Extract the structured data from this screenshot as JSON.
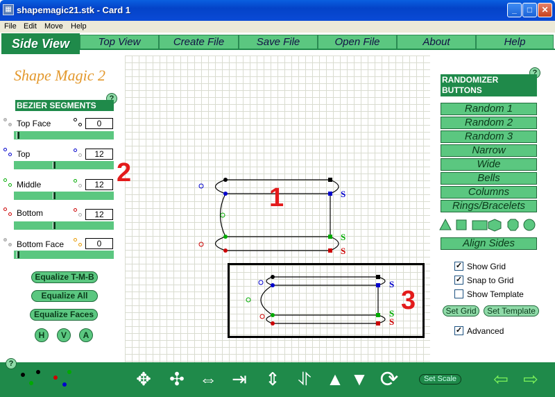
{
  "window": {
    "title": "shapemagic21.stk - Card 1"
  },
  "menus": [
    "File",
    "Edit",
    "Move",
    "Help"
  ],
  "tabs": {
    "side": "Side View",
    "items": [
      "Top View",
      "Create File",
      "Save File",
      "Open File",
      "About",
      "Help"
    ]
  },
  "logo": "Shape Magic 2",
  "help_glyph": "?",
  "bezier": {
    "header": "BEZIER SEGMENTS",
    "rows": [
      {
        "label": "Top Face",
        "value": "0",
        "level": 0.0
      },
      {
        "label": "Top",
        "value": "12",
        "level": 0.4
      },
      {
        "label": "Middle",
        "value": "12",
        "level": 0.4
      },
      {
        "label": "Bottom",
        "value": "12",
        "level": 0.4
      },
      {
        "label": "Bottom Face",
        "value": "0",
        "level": 0.0
      }
    ]
  },
  "equalize_buttons": [
    "Equalize T-M-B",
    "Equalize All",
    "Equalize Faces"
  ],
  "constraint_buttons": [
    "H",
    "V",
    "A"
  ],
  "canvas_labels": {
    "one": "1",
    "two": "2",
    "three": "3",
    "s": "S"
  },
  "randomizer": {
    "header_line1": "RANDOMIZER",
    "header_line2": "BUTTONS",
    "buttons": [
      "Random 1",
      "Random 2",
      "Random 3",
      "Narrow",
      "Wide",
      "Bells",
      "Columns",
      "Rings/Bracelets"
    ]
  },
  "shape_icons": [
    "triangle-icon",
    "square-icon",
    "rectangle-icon",
    "hexagon-icon",
    "octagon-icon",
    "circle-icon"
  ],
  "align_sides": "Align Sides",
  "checkboxes": [
    {
      "label": "Show Grid",
      "checked": true
    },
    {
      "label": "Snap to Grid",
      "checked": true
    },
    {
      "label": "Show Template",
      "checked": false
    }
  ],
  "set_grid": "Set Grid",
  "set_template": "Set Template",
  "advanced": {
    "label": "Advanced",
    "checked": true
  },
  "set_scale": "Set Scale",
  "colors": {
    "accent": "#1f8a4a",
    "button": "#5bc780",
    "logo": "#e3982c",
    "marker": "#e31b1b"
  }
}
